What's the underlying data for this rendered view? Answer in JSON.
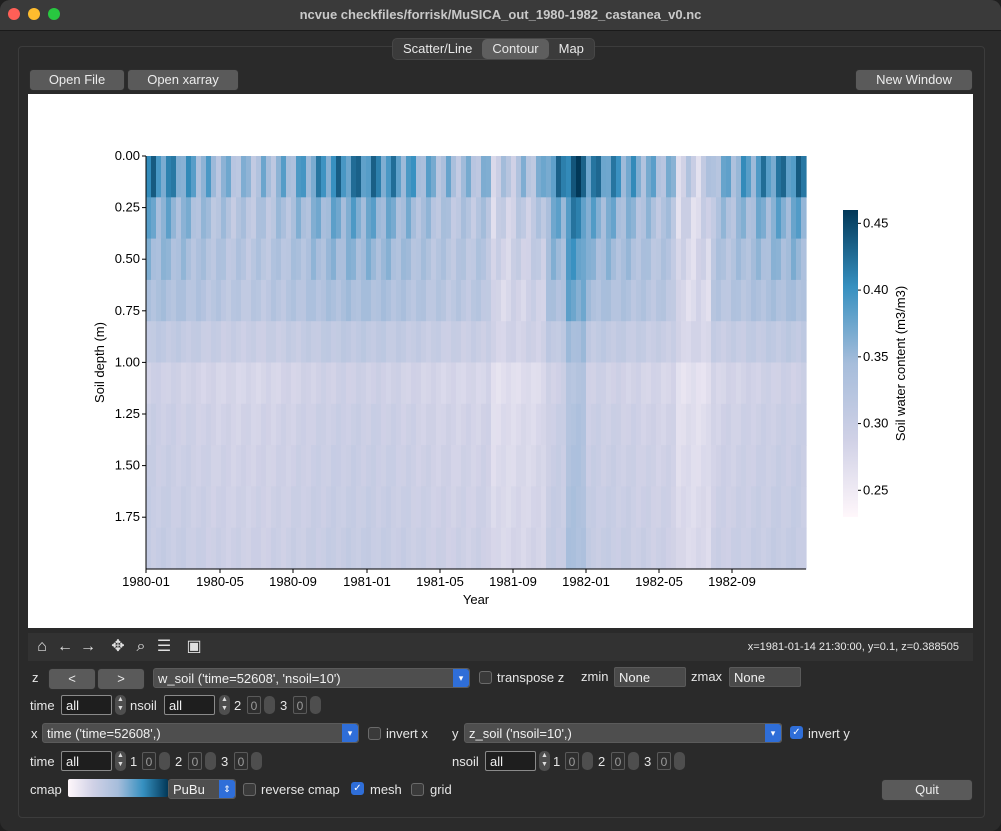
{
  "window": {
    "title": "ncvue checkfiles/forrisk/MuSICA_out_1980-1982_castanea_v0.nc"
  },
  "tabs": [
    "Scatter/Line",
    "Contour",
    "Map"
  ],
  "buttons": {
    "open_file": "Open File",
    "open_xarray": "Open xarray",
    "new_window": "New Window",
    "quit": "Quit",
    "prev": "<",
    "next": ">"
  },
  "chart_data": {
    "type": "heatmap",
    "xlabel": "Year",
    "ylabel": "Soil depth (m)",
    "colorbar_label": "Soil water content (m3/m3)",
    "x_ticks": [
      "1980-01",
      "1980-05",
      "1980-09",
      "1981-01",
      "1981-05",
      "1981-09",
      "1982-01",
      "1982-05",
      "1982-09"
    ],
    "y_ticks": [
      "0.00",
      "0.25",
      "0.50",
      "0.75",
      "1.00",
      "1.25",
      "1.50",
      "1.75"
    ],
    "colorbar_ticks": [
      "0.45",
      "0.40",
      "0.35",
      "0.30",
      "0.25"
    ],
    "colorbar_range": [
      0.23,
      0.46
    ],
    "cmap": "PuBu",
    "y_inverted": true
  },
  "status": {
    "coords": "x=1981-01-14 21:30:00, y=0.1, z=0.388505"
  },
  "controls": {
    "z_label": "z",
    "z_var": "w_soil ('time=52608', 'nsoil=10')",
    "transpose_z": "transpose z",
    "zmin_label": "zmin",
    "zmin": "None",
    "zmax_label": "zmax",
    "zmax": "None",
    "time_label": "time",
    "time_value": "all",
    "nsoil_label": "nsoil",
    "nsoil_value": "all",
    "dim2": "2",
    "dim3": "3",
    "zero": "0",
    "x_label": "x",
    "x_var": "time ('time=52608',)",
    "invert_x": "invert x",
    "y_label": "y",
    "y_var": "z_soil ('nsoil=10',)",
    "invert_y": "invert y",
    "dim1": "1",
    "cmap_label": "cmap",
    "cmap_value": "PuBu",
    "reverse_cmap": "reverse cmap",
    "mesh": "mesh",
    "grid": "grid"
  },
  "colors": {
    "accent": "#2f6ed8",
    "close": "#ff5f57",
    "minimize": "#febc2e",
    "zoom": "#28c840"
  }
}
